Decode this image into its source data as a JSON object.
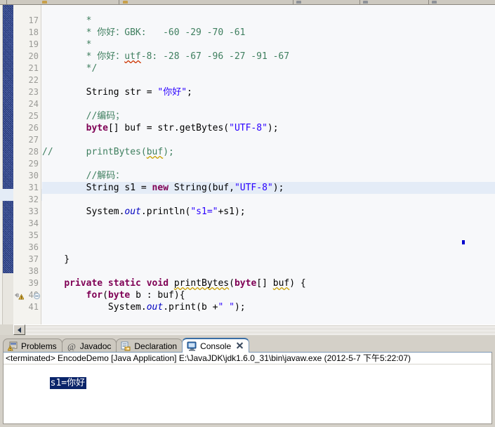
{
  "window": {
    "app": "Eclipse IDE",
    "background_color": "#d4d0c8"
  },
  "editor": {
    "first_visible_line": 17,
    "highlighted_line": 31,
    "warning_line": 39,
    "colors": {
      "background": "#f7f8fa",
      "gutter_background": "#f4f3ef",
      "line_number": "#9a9a96",
      "comment": "#3f7f5f",
      "keyword": "#7f0055",
      "string": "#2a00ff",
      "field": "#0000c0",
      "current_line_highlight": "#e4ecf7",
      "annotation_bar": "#2b3f8c"
    },
    "lines": [
      {
        "n": 17,
        "html": "        <span class='cmt'>*</span>"
      },
      {
        "n": 18,
        "html": "        <span class='cmt'>* 你好：GBK:   -60 -29 -70 -61</span>"
      },
      {
        "n": 19,
        "html": "        <span class='cmt'>*</span>"
      },
      {
        "n": 20,
        "html": "        <span class='cmt'>* 你好：<span class='sq-red'>utf</span>-8: -28 -67 -96 -27 -91 -67</span>"
      },
      {
        "n": 21,
        "html": "        <span class='cmt'>*/</span>"
      },
      {
        "n": 22,
        "html": ""
      },
      {
        "n": 23,
        "html": "        String str = <span class='str'>\"你好\"</span>;"
      },
      {
        "n": 24,
        "html": ""
      },
      {
        "n": 25,
        "html": "        <span class='cmt'>//编码；</span>"
      },
      {
        "n": 26,
        "html": "        <span class='kw'>byte</span>[] buf = str.getBytes(<span class='str'>\"UTF-8\"</span>);"
      },
      {
        "n": 27,
        "html": ""
      },
      {
        "n": 28,
        "html": "<span class='cmt'>//      printBytes(<span class='sq-yel'>buf</span>);</span>",
        "prefix_comment": true
      },
      {
        "n": 29,
        "html": ""
      },
      {
        "n": 30,
        "html": "        <span class='cmt'>//解码：</span>"
      },
      {
        "n": 31,
        "html": "        String s1 = <span class='kw'>new</span> String(buf,<span class='str'>\"UTF-8\"</span>);",
        "highlighted": true
      },
      {
        "n": 32,
        "html": ""
      },
      {
        "n": 33,
        "html": "        System.<span class='fld'>out</span>.println(<span class='str'>\"s1=\"</span>+s1);"
      },
      {
        "n": 34,
        "html": ""
      },
      {
        "n": 35,
        "html": ""
      },
      {
        "n": 36,
        "html": ""
      },
      {
        "n": 37,
        "html": "    }"
      },
      {
        "n": 38,
        "html": ""
      },
      {
        "n": 39,
        "html": "    <span class='kw'>private static void</span> <span class='sq-yel'>printBytes</span>(<span class='kw'>byte</span>[] <span class='sq-yel'>buf</span>) {",
        "fold": true,
        "warning": true
      },
      {
        "n": 40,
        "html": "        <span class='kw'>for</span>(<span class='kw'>byte</span> b : buf){"
      },
      {
        "n": 41,
        "html": "            System.<span class='fld'>out</span>.print(b +<span class='str'>\" \"</span>);"
      }
    ],
    "plain_lines": [
      "        *",
      "        * 你好：GBK:   -60 -29 -70 -61",
      "        *",
      "        * 你好：utf-8: -28 -67 -96 -27 -91 -67",
      "        */",
      "",
      "        String str = \"你好\";",
      "",
      "        //编码；",
      "        byte[] buf = str.getBytes(\"UTF-8\");",
      "",
      "//      printBytes(buf);",
      "",
      "        //解码：",
      "        String s1 = new String(buf,\"UTF-8\");",
      "",
      "        System.out.println(\"s1=\"+s1);",
      "",
      "",
      "",
      "    }",
      "",
      "    private static void printBytes(byte[] buf) {",
      "        for(byte b : buf){",
      "            System.out.print(b +\" \");"
    ],
    "scrollbar": {
      "left_arrow_label": "◄"
    }
  },
  "bottom_view": {
    "tabs": [
      {
        "label": "Problems",
        "icon": "problems-icon",
        "active": false,
        "closable": false
      },
      {
        "label": "Javadoc",
        "icon": "javadoc-icon",
        "active": false,
        "closable": false
      },
      {
        "label": "Declaration",
        "icon": "declaration-icon",
        "active": false,
        "closable": false
      },
      {
        "label": "Console",
        "icon": "console-icon",
        "active": true,
        "closable": true
      }
    ],
    "console": {
      "status_line": "<terminated> EncodeDemo [Java Application] E:\\JavaJDK\\jdk1.6.0_31\\bin\\javaw.exe (2012-5-7 下午5:22:07)",
      "output": "s1=你好",
      "output_selected": true,
      "selection_color": "#0a246a"
    }
  }
}
